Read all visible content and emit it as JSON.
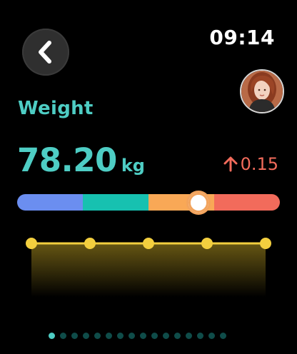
{
  "status": {
    "time": "09:14"
  },
  "nav": {
    "back_icon": "chevron-left-icon"
  },
  "profile": {
    "avatar_icon": "user-avatar"
  },
  "metric": {
    "label": "Weight",
    "value": "78.20",
    "unit": "kg",
    "delta": "0.15",
    "delta_direction": "up",
    "color": "#4ecdc4",
    "delta_color": "#f26b5b"
  },
  "range": {
    "segments": [
      "#6b8ef0",
      "#17c1b0",
      "#f9a856",
      "#f26b5b"
    ],
    "level": 0.69
  },
  "trend": {
    "points": [
      0.0,
      0.0,
      0.0,
      0.0,
      0.0
    ],
    "line_color": "#f3cf3f"
  },
  "pager": {
    "count": 16,
    "active": 0
  }
}
